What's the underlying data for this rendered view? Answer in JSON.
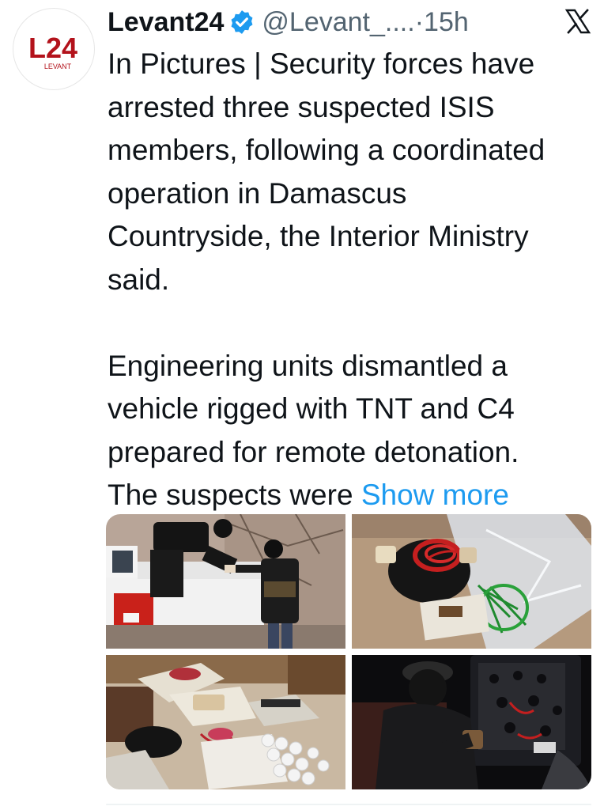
{
  "account": {
    "display_name": "Levant24",
    "handle": "@Levant_....",
    "separator": "·",
    "time": "15h",
    "verified_icon": "verified-badge-icon",
    "logo": {
      "mark": "L24",
      "subtitle": "LEVANT",
      "color": "#b3121b"
    }
  },
  "platform_icon": "x-logo-icon",
  "tweet": {
    "text": "In Pictures | Security forces have\narrested three suspected ISIS\nmembers, following a coordinated\noperation in Damascus\nCountryside, the Interior Ministry\nsaid.\n\nEngineering units dismantled a\nvehicle rigged with TNT and C4\nprepared for remote detonation.\nThe suspects were ",
    "show_more": "Show more"
  },
  "media": [
    {
      "name": "photo-arrest-at-pickup-truck"
    },
    {
      "name": "photo-seized-wires-and-bags"
    },
    {
      "name": "photo-seized-explosives-on-floor"
    },
    {
      "name": "photo-officer-inspecting-vehicle-door"
    }
  ],
  "colors": {
    "text": "#0f1419",
    "secondary": "#536471",
    "link": "#1d9bf0",
    "verified": "#1d9bf0",
    "brand": "#b3121b"
  }
}
